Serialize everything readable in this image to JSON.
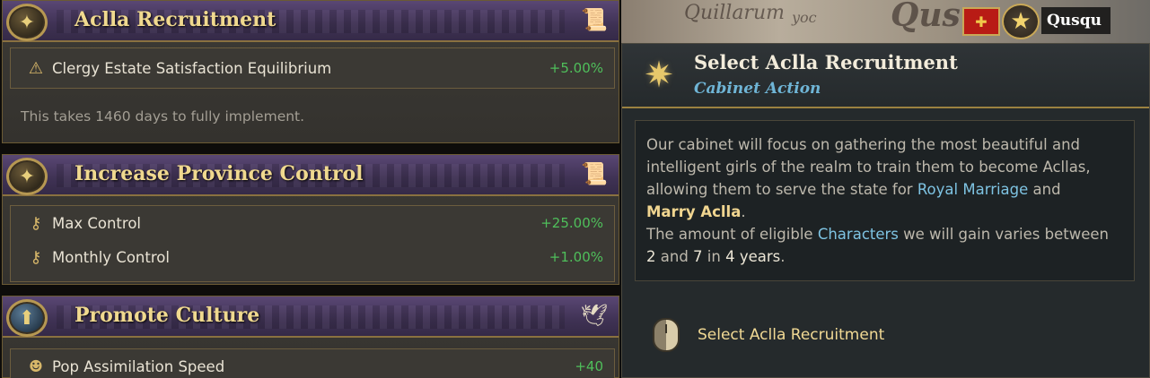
{
  "cards": [
    {
      "title": "Aclla Recruitment",
      "modifiers": [
        {
          "label": "Clergy Estate Satisfaction Equilibrium",
          "value": "+5.00%"
        }
      ],
      "note": "This takes 1460 days to fully implement."
    },
    {
      "title": "Increase Province Control",
      "modifiers": [
        {
          "label": "Max Control",
          "value": "+25.00%"
        },
        {
          "label": "Monthly Control",
          "value": "+1.00%"
        }
      ]
    },
    {
      "title": "Promote Culture",
      "modifiers": [
        {
          "label": "Pop Assimilation Speed",
          "value": "+40"
        }
      ]
    }
  ],
  "map": {
    "labels": [
      "Quillarum",
      "yoc",
      "Qus"
    ],
    "country": "Qusqu"
  },
  "tooltip": {
    "title": "Select Aclla Recruitment",
    "subtitle": "Cabinet Action",
    "body": {
      "p1": "Our cabinet will focus on gathering the most beautiful and intelligent girls of the realm to train them to become Acllas, allowing them to serve the state for ",
      "link1": "Royal Marriage",
      "and1": " and",
      "link2": "Marry Aclla",
      "dot1": ".",
      "p2": "The amount of eligible ",
      "link3": "Characters",
      "p2b": " we will gain varies between",
      "n1": "2",
      "and2": " and ",
      "n2": "7",
      "in": " in ",
      "n3": "4 years",
      "dot2": "."
    },
    "action_label": "Select Aclla Recruitment"
  },
  "colors": {
    "positive": "#4fbf5b",
    "header_purple": "#4a3b62",
    "link_blue": "#7ec3e2",
    "gold_text": "#f0d98f"
  },
  "icons": {
    "card1_medal": "star-medal-icon",
    "card2_medal": "star-medal-icon",
    "card3_medal": "pop-culture-icon",
    "card1_corner": "scroll-icon",
    "card2_corner": "scroll-icon",
    "card3_corner": "dove-icon"
  }
}
